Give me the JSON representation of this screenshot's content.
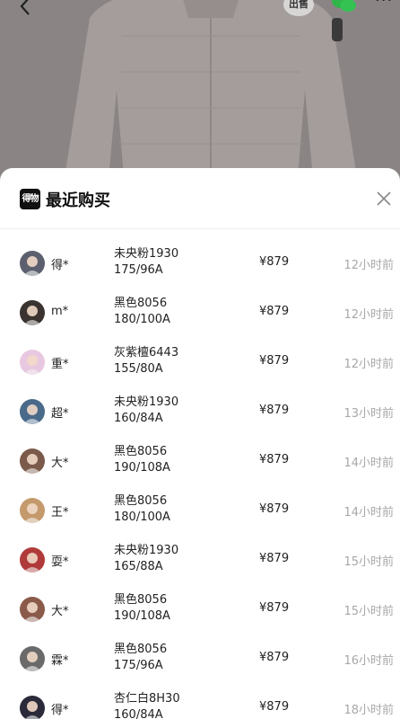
{
  "header": {
    "sell_label": "出售",
    "more_label": "···"
  },
  "sheet": {
    "brand_logo_text": "得物",
    "title": "最近购买"
  },
  "purchases": [
    {
      "user": "得*",
      "color": "未央粉1930",
      "size": "175/96A",
      "price": "¥879",
      "time": "12小时前",
      "avatar_color": "#5b5f6e"
    },
    {
      "user": "m*",
      "color": "黑色8056",
      "size": "180/100A",
      "price": "¥879",
      "time": "12小时前",
      "avatar_color": "#3a3330"
    },
    {
      "user": "重*",
      "color": "灰紫檀6443",
      "size": "155/80A",
      "price": "¥879",
      "time": "12小时前",
      "avatar_color": "#e8c8e0"
    },
    {
      "user": "超*",
      "color": "未央粉1930",
      "size": "160/84A",
      "price": "¥879",
      "time": "13小时前",
      "avatar_color": "#4a6a8a"
    },
    {
      "user": "大*",
      "color": "黑色8056",
      "size": "190/108A",
      "price": "¥879",
      "time": "14小时前",
      "avatar_color": "#7a5a4a"
    },
    {
      "user": "王*",
      "color": "黑色8056",
      "size": "180/100A",
      "price": "¥879",
      "time": "14小时前",
      "avatar_color": "#c49a6c"
    },
    {
      "user": "耍*",
      "color": "未央粉1930",
      "size": "165/88A",
      "price": "¥879",
      "time": "15小时前",
      "avatar_color": "#b03a3a"
    },
    {
      "user": "大*",
      "color": "黑色8056",
      "size": "190/108A",
      "price": "¥879",
      "time": "15小时前",
      "avatar_color": "#8a5a4a"
    },
    {
      "user": "霖*",
      "color": "黑色8056",
      "size": "175/96A",
      "price": "¥879",
      "time": "16小时前",
      "avatar_color": "#6a6a6a"
    },
    {
      "user": "得*",
      "color": "杏仁白8H30",
      "size": "160/84A",
      "price": "¥879",
      "time": "18小时前",
      "avatar_color": "#2a2a3a"
    }
  ],
  "colors": {
    "backdrop": "#8a8584",
    "jacket": "#a9a2a0",
    "time_text": "#a8a8a8"
  }
}
